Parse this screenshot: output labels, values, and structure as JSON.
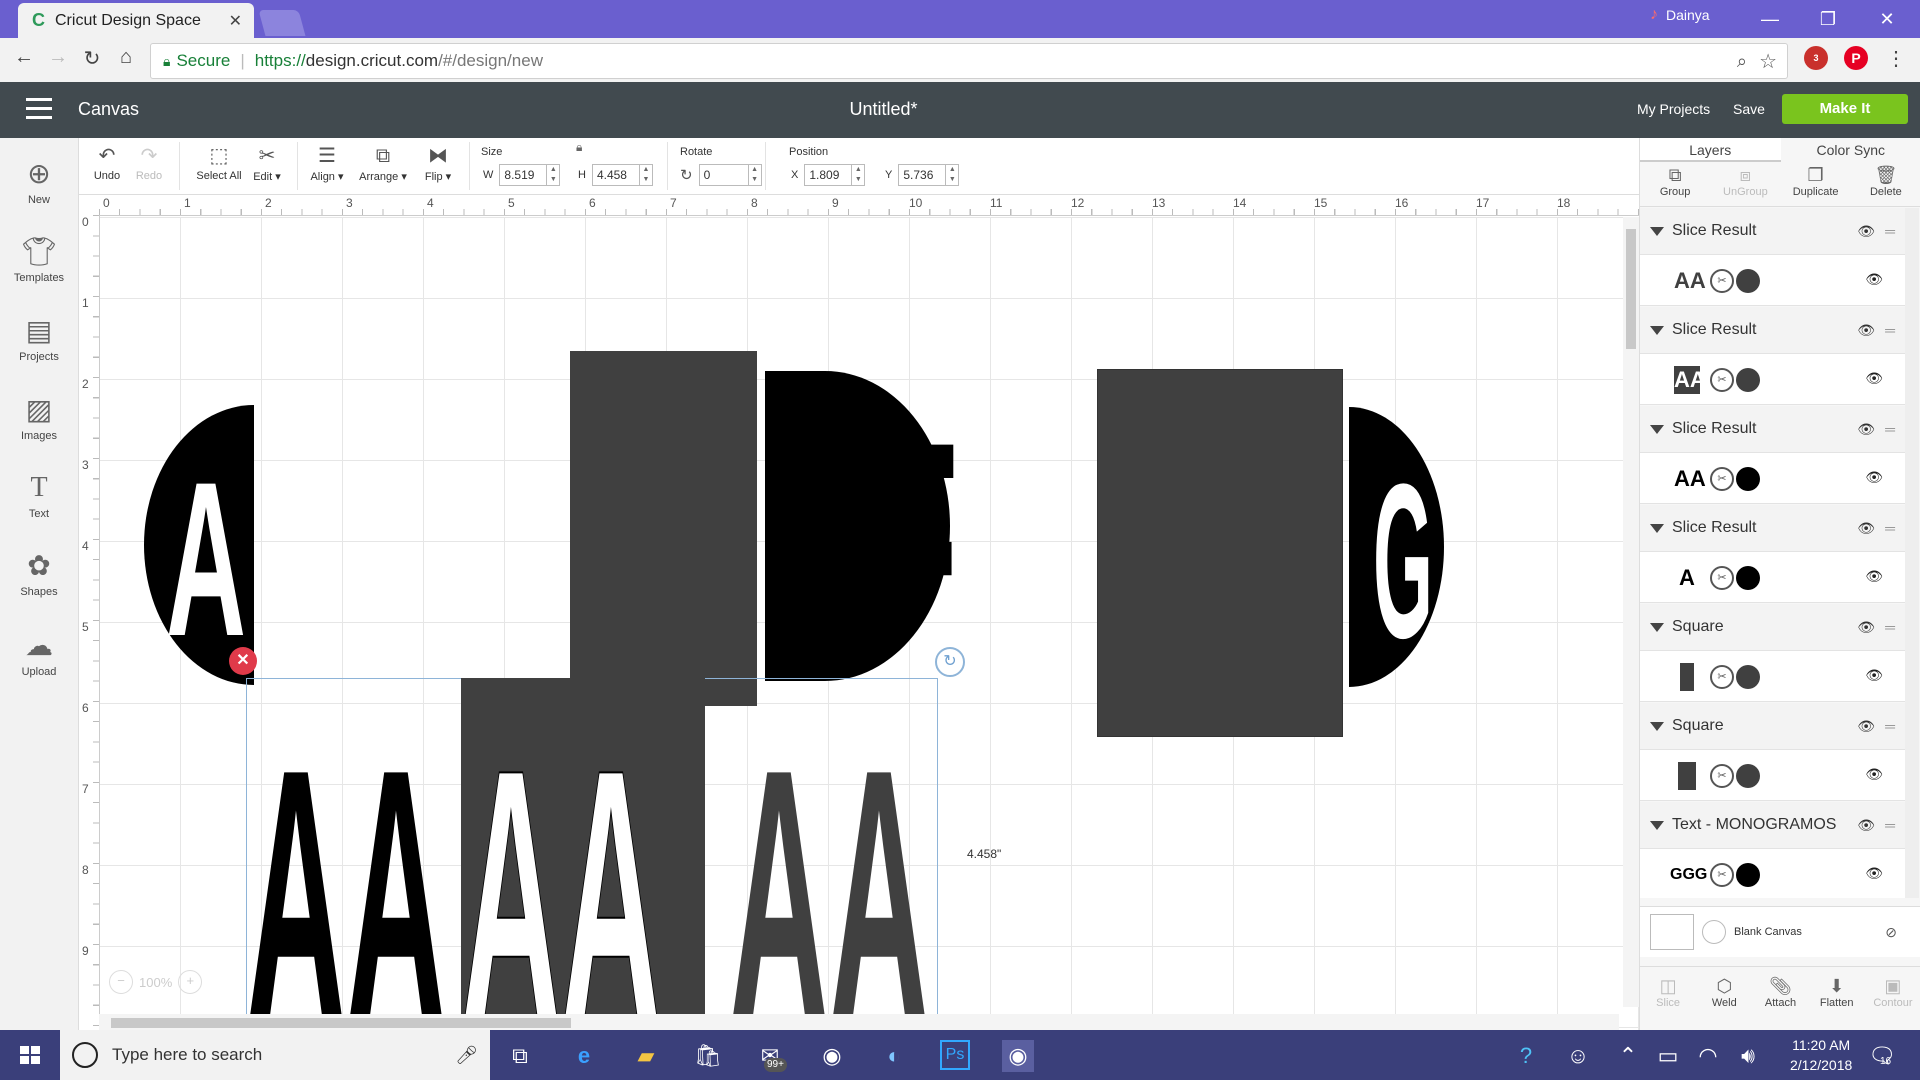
{
  "browser": {
    "tab_title": "Cricut Design Space",
    "profile_name": "Dainya",
    "secure_label": "Secure",
    "url_scheme": "https://",
    "url_host": "design.cricut.com",
    "url_path": "/#/design/new",
    "ext_badge": "3"
  },
  "header": {
    "canvas_label": "Canvas",
    "doc_title": "Untitled*",
    "my_projects": "My Projects",
    "save": "Save",
    "make_it": "Make It"
  },
  "leftnav": [
    {
      "label": "New",
      "icon": "plus-circle-icon"
    },
    {
      "label": "Templates",
      "icon": "tshirt-icon"
    },
    {
      "label": "Projects",
      "icon": "projects-icon"
    },
    {
      "label": "Images",
      "icon": "image-icon"
    },
    {
      "label": "Text",
      "icon": "text-icon"
    },
    {
      "label": "Shapes",
      "icon": "shapes-icon"
    },
    {
      "label": "Upload",
      "icon": "upload-icon"
    }
  ],
  "toolbar": {
    "undo": "Undo",
    "redo": "Redo",
    "select_all": "Select All",
    "edit": "Edit",
    "align": "Align",
    "arrange": "Arrange",
    "flip": "Flip",
    "size_label": "Size",
    "w_label": "W",
    "w_value": "8.519",
    "h_label": "H",
    "h_value": "4.458",
    "rotate_label": "Rotate",
    "rotate_value": "0",
    "position_label": "Position",
    "x_label": "X",
    "x_value": "1.809",
    "y_label": "Y",
    "y_value": "5.736"
  },
  "rulers": {
    "h": [
      "0",
      "1",
      "2",
      "3",
      "4",
      "5",
      "6",
      "7",
      "8",
      "9",
      "10",
      "11",
      "12",
      "13",
      "14",
      "15",
      "16",
      "17",
      "18"
    ],
    "v": [
      "0",
      "1",
      "2",
      "3",
      "4",
      "5",
      "6",
      "7",
      "8",
      "9"
    ]
  },
  "canvas": {
    "dimension_label": "4.458\"",
    "zoom_label": "100%",
    "letters": {
      "a_left": "A",
      "ff": "FF",
      "g": "G",
      "aa1": "AA",
      "aa2": "AA",
      "aa3": "AA"
    }
  },
  "panel": {
    "tab_layers": "Layers",
    "tab_color_sync": "Color Sync",
    "tools": [
      {
        "label": "Group",
        "disabled": false
      },
      {
        "label": "UnGroup",
        "disabled": true
      },
      {
        "label": "Duplicate",
        "disabled": false
      },
      {
        "label": "Delete",
        "disabled": false
      }
    ],
    "layers": [
      {
        "name": "Slice Result",
        "thumb": "AA",
        "color": "#404040"
      },
      {
        "name": "Slice Result",
        "thumb": "AA",
        "color": "#404040"
      },
      {
        "name": "Slice Result",
        "thumb": "AA",
        "color": "#000000"
      },
      {
        "name": "Slice Result",
        "thumb": "A",
        "color": "#000000"
      },
      {
        "name": "Square",
        "thumb": "",
        "color": "#404040"
      },
      {
        "name": "Square",
        "thumb": "",
        "color": "#404040"
      },
      {
        "name": "Text - MONOGRAMOS",
        "thumb": "GGG",
        "color": "#000000"
      }
    ],
    "blank_canvas": "Blank Canvas",
    "bottom_tools": [
      {
        "label": "Slice",
        "disabled": true
      },
      {
        "label": "Weld",
        "disabled": false
      },
      {
        "label": "Attach",
        "disabled": false
      },
      {
        "label": "Flatten",
        "disabled": false
      },
      {
        "label": "Contour",
        "disabled": true
      }
    ]
  },
  "taskbar": {
    "search_placeholder": "Type here to search",
    "mail_badge": "99+",
    "time": "11:20 AM",
    "date": "2/12/2018",
    "notif_count": "16"
  }
}
